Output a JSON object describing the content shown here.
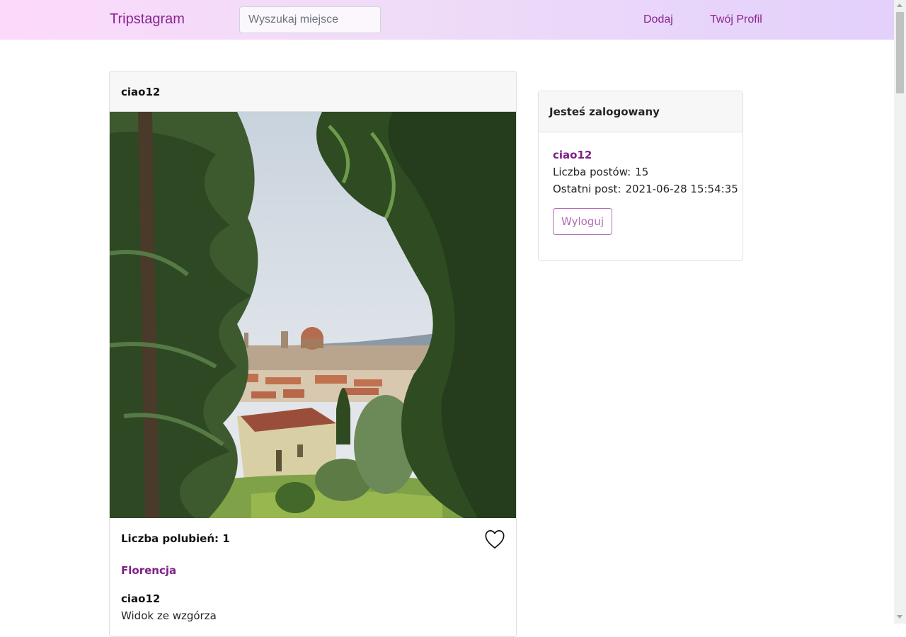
{
  "navbar": {
    "brand": "Tripstagram",
    "search_placeholder": "Wyszukaj miejsce",
    "add_label": "Dodaj",
    "profile_label": "Twój Profil"
  },
  "post": {
    "author": "ciao12",
    "likes_label": "Liczba polubień: 1",
    "place": "Florencja",
    "comment_author": "ciao12",
    "comment_text": "Widok ze wzgórza"
  },
  "sidebar": {
    "title": "Jesteś zalogowany",
    "username": "ciao12",
    "posts_label": "Liczba postów:",
    "posts_value": "15",
    "last_post_label": "Ostatni post:",
    "last_post_value": "2021-06-28 15:54:35",
    "logout_label": "Wyloguj"
  },
  "colors": {
    "accent": "#7e1f86",
    "nav_gradient_start": "#fcd9fb",
    "nav_gradient_end": "#e3d0fb"
  },
  "icons": {
    "like": "heart-outline-icon"
  }
}
